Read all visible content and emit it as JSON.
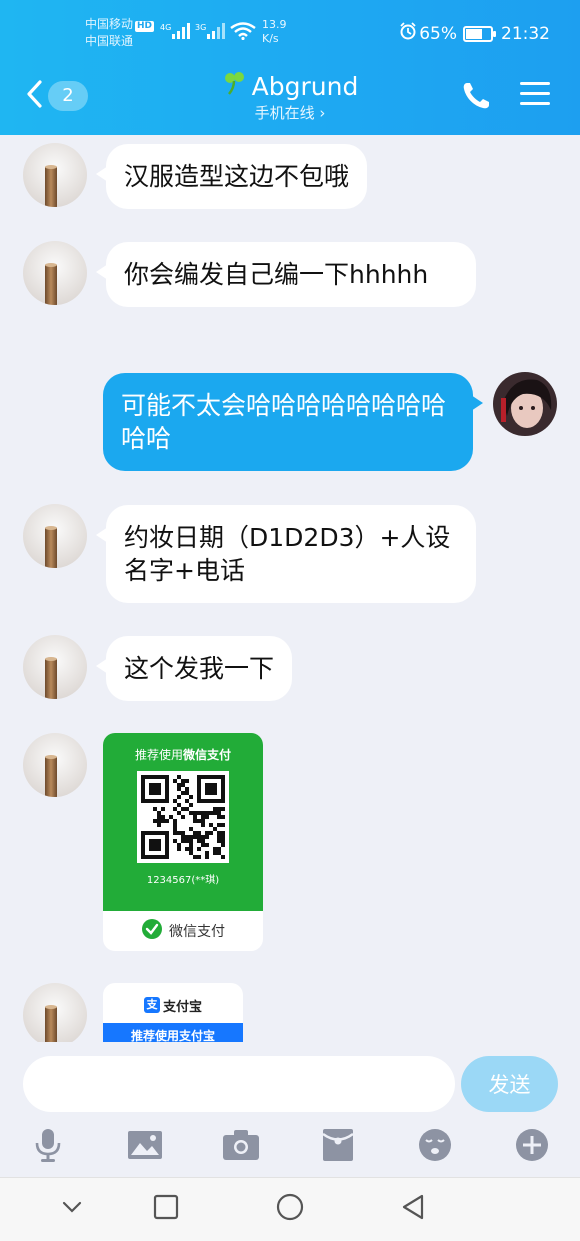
{
  "status_bar": {
    "carrier1": "中国移动",
    "hd": "HD",
    "carrier2": "中国联通",
    "net1": "4G",
    "net2": "3G",
    "speed_value": "13.9",
    "speed_unit": "K/s",
    "battery_text": "65%",
    "battery_level": 0.65,
    "time": "21:32"
  },
  "header": {
    "unread_count": "2",
    "contact_name": "Abgrund",
    "presence": "手机在线",
    "presence_chevron": "›",
    "icons": {
      "back": "chevron-left-icon",
      "call": "phone-icon",
      "menu": "menu-icon",
      "status": "clover-icon"
    },
    "colors": {
      "header_start": "#1fb6f2",
      "header_end": "#1d9ff0",
      "out_bubble": "#1ba8ef"
    }
  },
  "messages": [
    {
      "direction": "incoming",
      "text": "汉服造型这边不包哦"
    },
    {
      "direction": "incoming",
      "text": "你会编发自己编一下hhhhh"
    },
    {
      "direction": "outgoing",
      "text": "可能不太会哈哈哈哈哈哈哈哈哈哈"
    },
    {
      "direction": "incoming",
      "text": "约妆日期（D1D2D3）+人设名字+电话"
    },
    {
      "direction": "incoming",
      "text": "这个发我一下"
    },
    {
      "direction": "incoming",
      "type": "image",
      "card": {
        "title_prefix": "推荐使用",
        "title_bold": "微信支付",
        "id": "1234567(**琪)",
        "footer": "微信支付"
      }
    },
    {
      "direction": "incoming",
      "type": "image",
      "card": {
        "brand": "支付宝",
        "brand_mark": "支",
        "banner": "推荐使用支付宝"
      }
    }
  ],
  "composer": {
    "placeholder": "",
    "send_label": "发送"
  },
  "toolbar": [
    "microphone-icon",
    "image-icon",
    "camera-icon",
    "red-packet-icon",
    "emoji-icon",
    "plus-icon"
  ],
  "navbar": [
    "chevron-down-icon",
    "recent-apps-icon",
    "home-icon",
    "back-icon"
  ]
}
